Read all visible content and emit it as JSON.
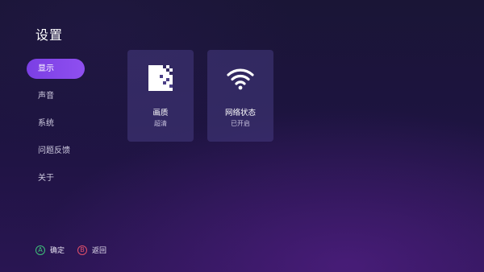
{
  "page": {
    "title": "设置"
  },
  "sidebar": {
    "items": [
      {
        "label": "显示",
        "active": true
      },
      {
        "label": "声音",
        "active": false
      },
      {
        "label": "系统",
        "active": false
      },
      {
        "label": "问题反馈",
        "active": false
      },
      {
        "label": "关于",
        "active": false
      }
    ]
  },
  "cards": {
    "quality": {
      "title": "画质",
      "value": "超清",
      "icon": "picture-quality-icon"
    },
    "network": {
      "title": "网络状态",
      "value": "已开启",
      "icon": "wifi-icon"
    }
  },
  "hints": {
    "confirm": {
      "key": "A",
      "label": "确定"
    },
    "back": {
      "key": "B",
      "label": "返回"
    }
  },
  "colors": {
    "accent": "#8045ea",
    "confirm_key": "#3ec07a",
    "back_key": "#e0506a"
  }
}
